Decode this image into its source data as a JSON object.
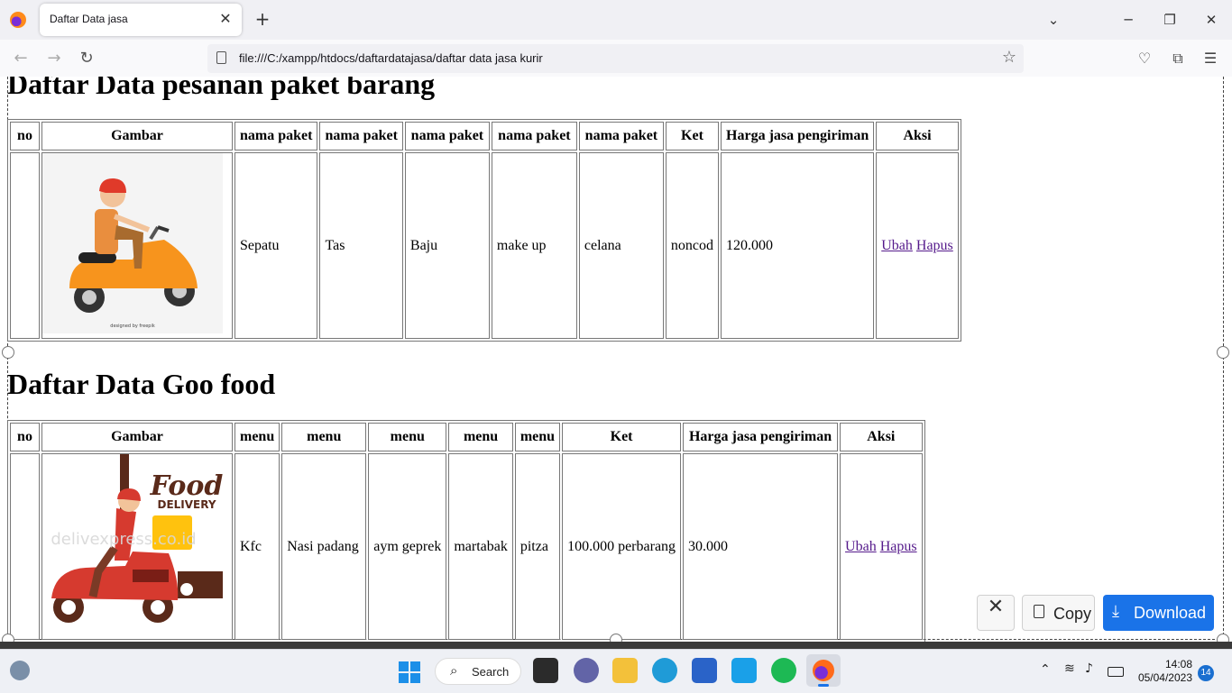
{
  "browser": {
    "tab_title": "Daftar Data jasa",
    "url": "file:///C:/xampp/htdocs/daftardatajasa/daftar data jasa kurir"
  },
  "section1": {
    "title": "Daftar Data pesanan paket barang",
    "headers": [
      "no",
      "Gambar",
      "nama paket",
      "nama paket",
      "nama paket",
      "nama paket",
      "nama paket",
      "Ket",
      "Harga jasa pengiriman",
      "Aksi"
    ],
    "row": {
      "no": "",
      "items": [
        "Sepatu",
        "Tas",
        "Baju",
        "make up",
        "celana"
      ],
      "ket": "noncod",
      "harga": "120.000",
      "image_caption": "designed by freepik"
    },
    "actions": [
      "Ubah",
      "Hapus"
    ]
  },
  "section2": {
    "title": "Daftar Data Goo food",
    "headers": [
      "no",
      "Gambar",
      "menu",
      "menu",
      "menu",
      "menu",
      "menu",
      "Ket",
      "Harga jasa pengiriman",
      "Aksi"
    ],
    "row": {
      "no": "",
      "items": [
        "Kfc",
        "Nasi padang",
        "aym geprek",
        "martabak",
        "pitza"
      ],
      "ket": "100.000 perbarang",
      "harga": "30.000",
      "logo_line1": "Food",
      "logo_line2": "DELIVERY",
      "watermark": "delivexpress.co.id"
    },
    "actions": [
      "Ubah",
      "Hapus"
    ]
  },
  "overlay": {
    "copy_label": "Copy",
    "download_label": "Download"
  },
  "taskbar": {
    "search_label": "Search",
    "time": "14:08",
    "date": "05/04/2023",
    "notification_count": "14"
  },
  "colors": {
    "link": "#551a8b",
    "download_button": "#1a73e8",
    "scooter_orange": "#f7941d",
    "scooter_red": "#d63a2f"
  }
}
